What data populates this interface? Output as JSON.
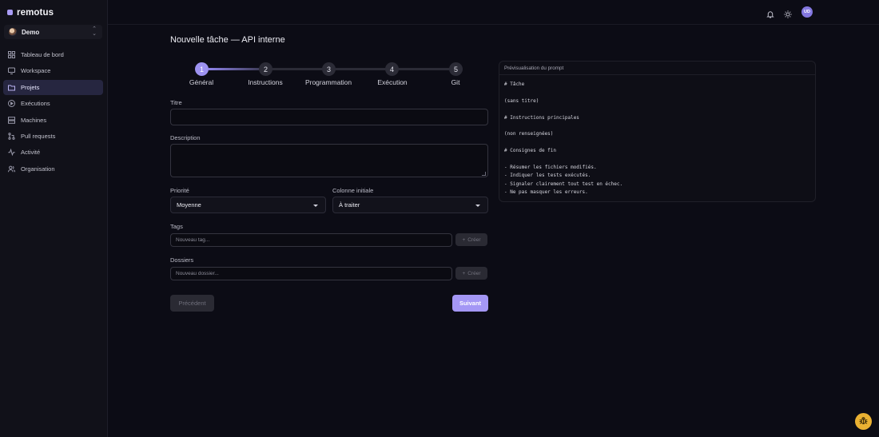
{
  "app": {
    "name": "remotus",
    "workspace": "Demo",
    "user_initials": "UD"
  },
  "sidebar": {
    "items": [
      {
        "label": "Tableau de bord",
        "icon": "dashboard-icon",
        "active": false
      },
      {
        "label": "Workspace",
        "icon": "workspace-icon",
        "active": false
      },
      {
        "label": "Projets",
        "icon": "folder-icon",
        "active": true
      },
      {
        "label": "Exécutions",
        "icon": "play-circle-icon",
        "active": false
      },
      {
        "label": "Machines",
        "icon": "server-icon",
        "active": false
      },
      {
        "label": "Pull requests",
        "icon": "git-pull-request-icon",
        "active": false
      },
      {
        "label": "Activité",
        "icon": "activity-icon",
        "active": false
      },
      {
        "label": "Organisation",
        "icon": "users-icon",
        "active": false
      }
    ]
  },
  "topbar": {
    "icons": [
      "bell-icon",
      "sun-icon"
    ]
  },
  "page": {
    "title": "Nouvelle tâche — API interne"
  },
  "stepper": {
    "current": 1,
    "steps": [
      {
        "number": "1",
        "label": "Général"
      },
      {
        "number": "2",
        "label": "Instructions"
      },
      {
        "number": "3",
        "label": "Programmation"
      },
      {
        "number": "4",
        "label": "Exécution"
      },
      {
        "number": "5",
        "label": "Git"
      }
    ]
  },
  "form": {
    "title_label": "Titre",
    "title_value": "",
    "description_label": "Description",
    "description_value": "",
    "priority_label": "Priorité",
    "priority_value": "Moyenne",
    "column_label": "Colonne initiale",
    "column_value": "À traiter",
    "tags_label": "Tags",
    "tags_placeholder": "Nouveau tag...",
    "tags_add": "Créer",
    "folders_label": "Dossiers",
    "folders_placeholder": "Nouveau dossier...",
    "folders_add": "Créer",
    "prev_label": "Précédent",
    "next_label": "Suivant"
  },
  "preview": {
    "title": "Prévisualisation du prompt",
    "lines": [
      "# Tâche",
      "",
      "(sans titre)",
      "",
      "# Instructions principales",
      "",
      "(non renseignées)",
      "",
      "# Consignes de fin",
      "",
      "- Résumer les fichiers modifiés.",
      "- Indiquer les tests exécutés.",
      "- Signaler clairement tout test en échec.",
      "- Ne pas masquer les erreurs."
    ]
  },
  "fab": {
    "icon": "bug-icon"
  }
}
